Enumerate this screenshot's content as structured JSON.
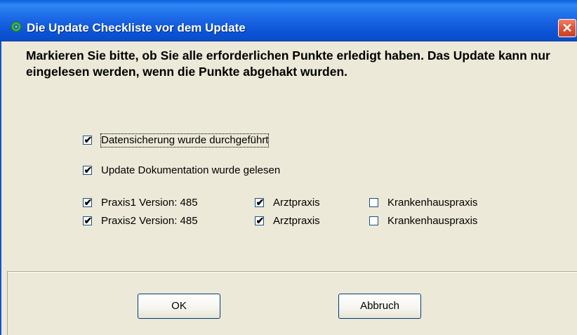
{
  "window": {
    "title": "Die Update Checkliste vor dem Update",
    "close_symbol": "✕",
    "app_icon": "green-gear-icon"
  },
  "instructions": "Markieren Sie bitte, ob Sie alle erforderlichen Punkte erledigt haben. Das Update kann nur eingelesen werden, wenn die Punkte abgehakt wurden.",
  "checks": {
    "backup": {
      "label": "Datensicherung wurde durchgeführt",
      "checked": true
    },
    "docs": {
      "label": "Update Dokumentation wurde gelesen",
      "checked": true
    },
    "praxis1": {
      "version_label": "Praxis1 Version: 485",
      "version_checked": true,
      "arzt_label": "Arztpraxis",
      "arzt_checked": true,
      "kh_label": "Krankenhauspraxis",
      "kh_checked": false
    },
    "praxis2": {
      "version_label": "Praxis2 Version: 485",
      "version_checked": true,
      "arzt_label": "Arztpraxis",
      "arzt_checked": true,
      "kh_label": "Krankenhauspraxis",
      "kh_checked": false
    }
  },
  "checkmark": "✔",
  "buttons": {
    "ok": "OK",
    "cancel": "Abbruch"
  }
}
